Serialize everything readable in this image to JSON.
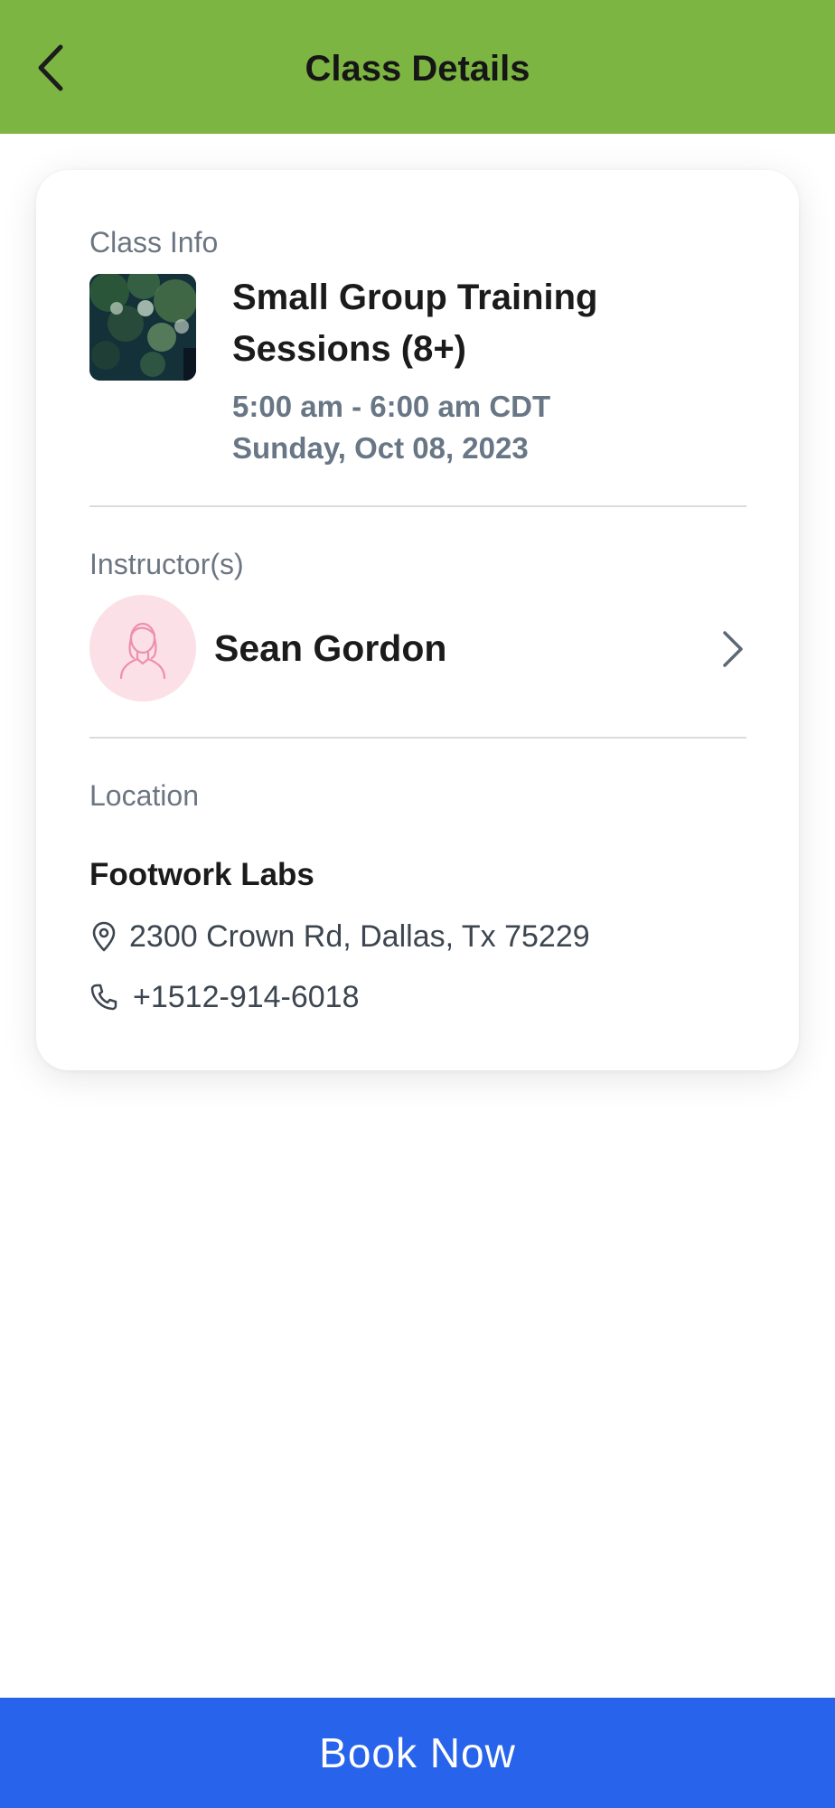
{
  "header": {
    "title": "Class Details",
    "back_icon": "chevron-left-icon"
  },
  "class_info": {
    "label": "Class Info",
    "title": "Small Group Training Sessions (8+)",
    "time": "5:00 am - 6:00 am CDT",
    "date": "Sunday, Oct 08, 2023"
  },
  "instructors": {
    "label": "Instructor(s)",
    "name": "Sean Gordon",
    "avatar_icon": "person-outline-icon",
    "chevron_icon": "chevron-right-icon"
  },
  "location": {
    "label": "Location",
    "name": "Footwork Labs",
    "address": "2300 Crown Rd, Dallas, Tx 75229",
    "phone": "+1512-914-6018",
    "address_icon": "map-pin-icon",
    "phone_icon": "phone-icon"
  },
  "footer": {
    "book_label": "Book Now"
  },
  "colors": {
    "header_green": "#7db543",
    "book_blue": "#2764eb",
    "avatar_pink": "#fbe0e8",
    "muted_text": "#6c7682"
  }
}
